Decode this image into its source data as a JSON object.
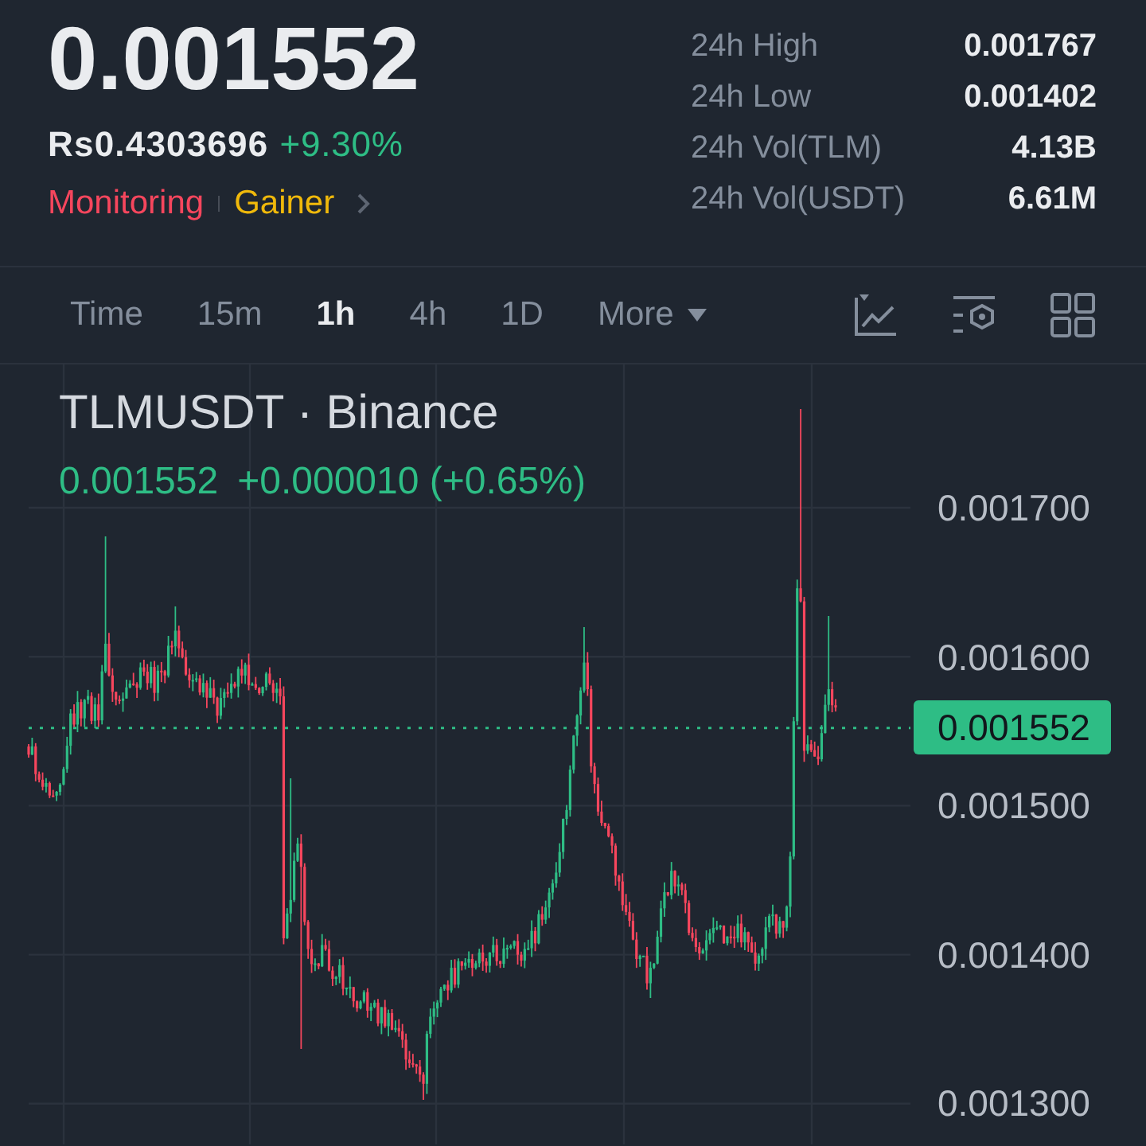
{
  "ticker": {
    "price": "0.001552",
    "local_price": "Rs0.4303696",
    "change": "+9.30%",
    "tags": [
      {
        "label": "Monitoring",
        "color": "#f6465d"
      },
      {
        "label": "Gainer",
        "color": "#f0b90b"
      }
    ]
  },
  "stats": [
    {
      "label": "24h High",
      "value": "0.001767"
    },
    {
      "label": "24h Low",
      "value": "0.001402"
    },
    {
      "label": "24h Vol(TLM)",
      "value": "4.13B"
    },
    {
      "label": "24h Vol(USDT)",
      "value": "6.61M"
    }
  ],
  "intervals": [
    {
      "label": "Time",
      "kind": "interval",
      "selected": false
    },
    {
      "label": "15m",
      "kind": "interval",
      "selected": false
    },
    {
      "label": "1h",
      "kind": "interval",
      "selected": true
    },
    {
      "label": "4h",
      "kind": "interval",
      "selected": false
    },
    {
      "label": "1D",
      "kind": "interval",
      "selected": false
    },
    {
      "label": "More",
      "kind": "dropdown",
      "selected": false
    }
  ],
  "chart": {
    "title": "TLMUSDT · Binance",
    "last_price": "0.001552",
    "change": "+0.000010 (+0.65%)",
    "y_axis": [
      "0.001700",
      "0.001600",
      "0.001500",
      "0.001400",
      "0.001300"
    ],
    "price_tag": "0.001552"
  }
}
